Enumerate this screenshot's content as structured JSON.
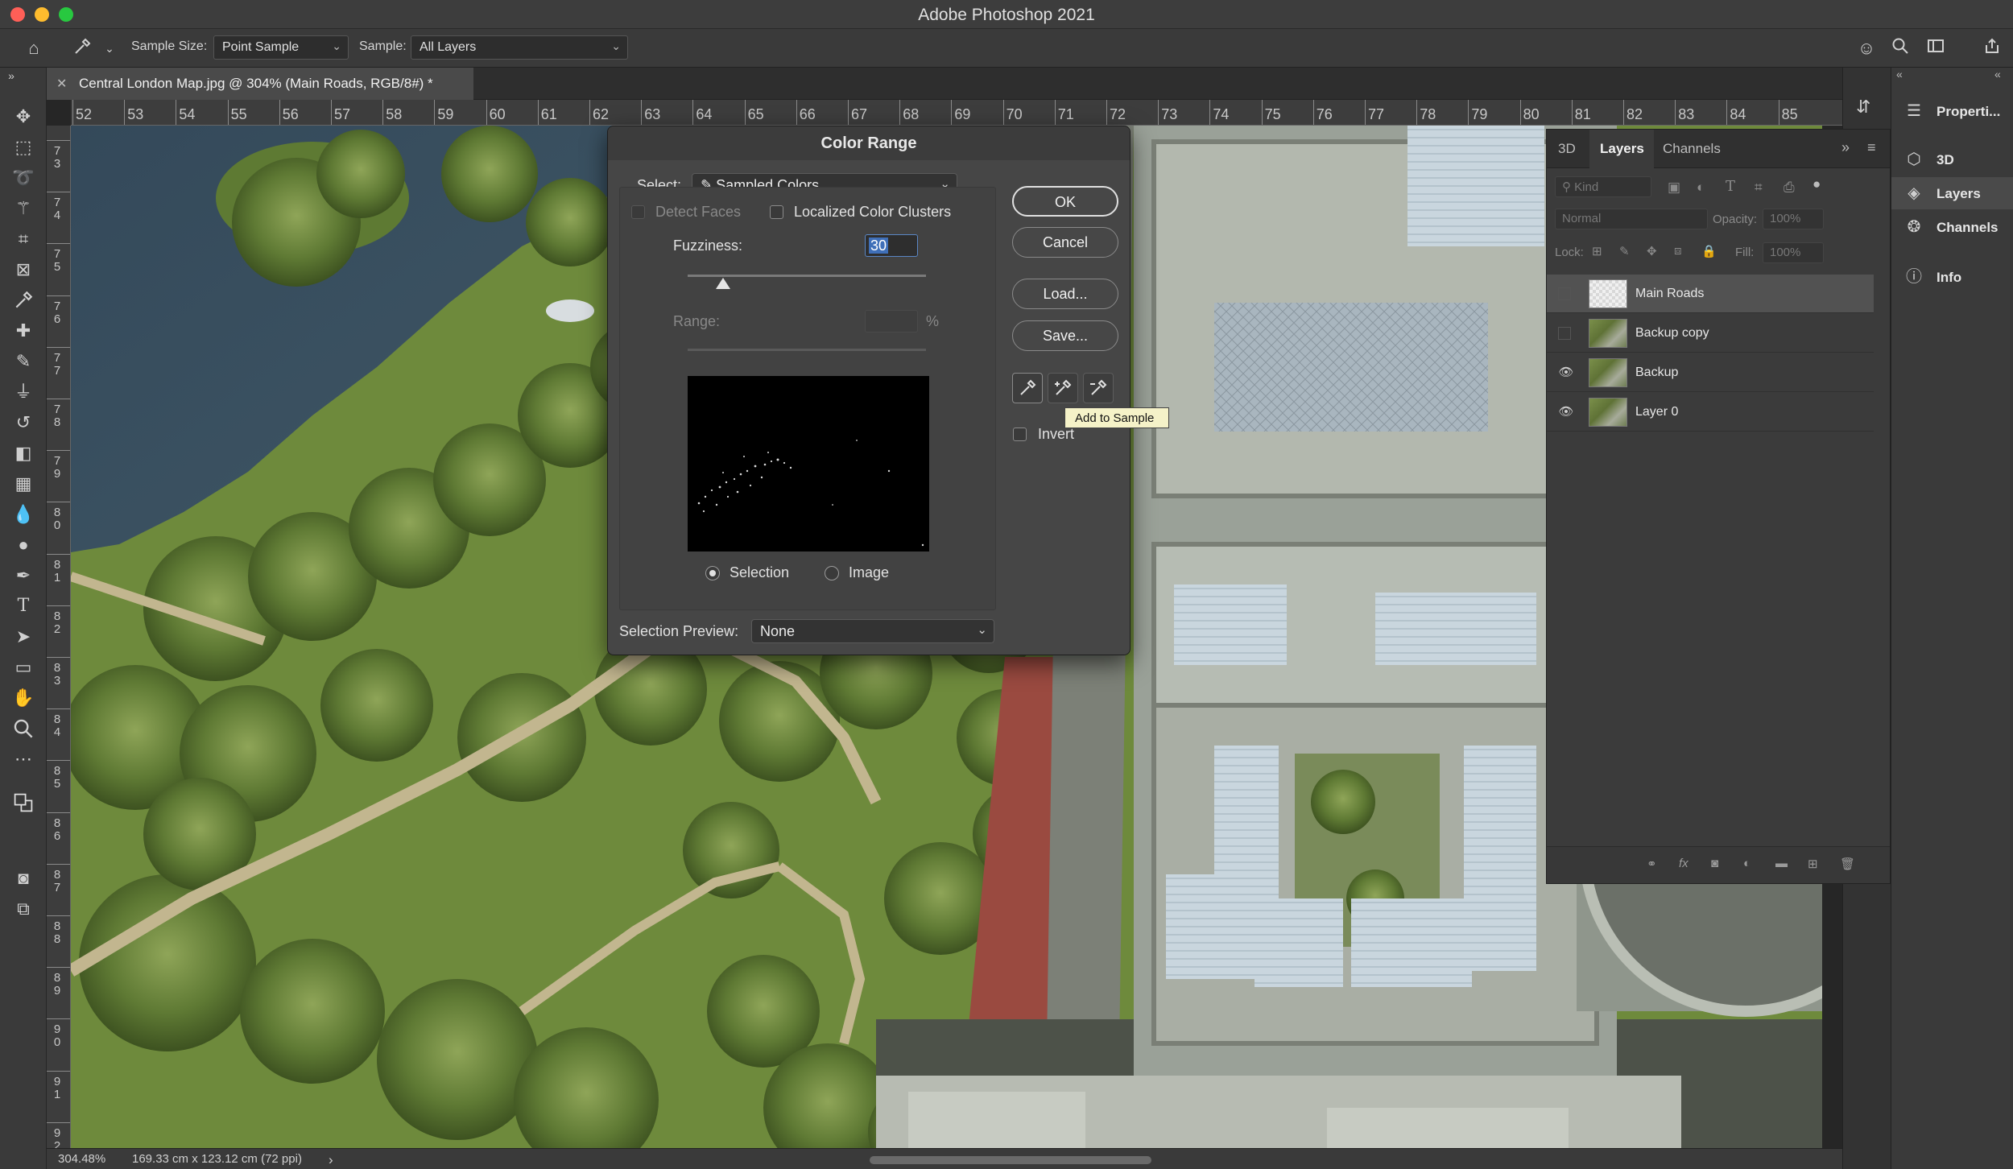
{
  "window": {
    "title": "Adobe Photoshop 2021"
  },
  "options_bar": {
    "tool_icon": "eyedropper-icon",
    "sample_size_label": "Sample Size:",
    "sample_size_value": "Point Sample",
    "sample_label": "Sample:",
    "sample_value": "All Layers",
    "right_icons": [
      "user-icon",
      "search-icon",
      "workspace-icon",
      "share-icon"
    ]
  },
  "document": {
    "tab_title": "Central London Map.jpg @ 304% (Main Roads, RGB/8#) *"
  },
  "rulers": {
    "horizontal": [
      "52",
      "53",
      "54",
      "55",
      "56",
      "57",
      "58",
      "59",
      "60",
      "61",
      "62",
      "63",
      "64",
      "65",
      "66",
      "67",
      "68",
      "69",
      "70",
      "71",
      "72",
      "73",
      "74",
      "75",
      "76",
      "77",
      "78",
      "79",
      "80",
      "81",
      "82",
      "83",
      "84",
      "85"
    ],
    "vertical": [
      "7\n3",
      "7\n4",
      "7\n5",
      "7\n6",
      "7\n7",
      "7\n8",
      "7\n9",
      "8\n0",
      "8\n1",
      "8\n2",
      "8\n3",
      "8\n4",
      "8\n5",
      "8\n6",
      "8\n7",
      "8\n8",
      "8\n9",
      "9\n0",
      "9\n1",
      "9\n2"
    ]
  },
  "status_bar": {
    "zoom": "304.48%",
    "doc_info": "169.33 cm x 123.12 cm (72 ppi)",
    "arrow": "›"
  },
  "dialog": {
    "title": "Color Range",
    "select_label": "Select:",
    "select_value": "Sampled Colors",
    "detect_faces_label": "Detect Faces",
    "localized_label": "Localized Color Clusters",
    "fuzziness_label": "Fuzziness:",
    "fuzziness_value": "30",
    "fuzziness_fraction": 0.15,
    "range_label": "Range:",
    "range_unit": "%",
    "selection_radio_label": "Selection",
    "image_radio_label": "Image",
    "preview_label": "Selection Preview:",
    "preview_value": "None",
    "buttons": {
      "ok": "OK",
      "cancel": "Cancel",
      "load": "Load...",
      "save": "Save..."
    },
    "invert_label": "Invert",
    "tooltip": "Add to Sample"
  },
  "layers_panel": {
    "tabs": [
      "3D",
      "Layers",
      "Channels"
    ],
    "active_tab": "Layers",
    "filter_placeholder": "Kind",
    "blend_mode": "Normal",
    "opacity_label": "Opacity:",
    "opacity_value": "100%",
    "lock_label": "Lock:",
    "fill_label": "Fill:",
    "fill_value": "100%",
    "layers": [
      {
        "name": "Main Roads",
        "visible": false,
        "selected": true
      },
      {
        "name": "Backup copy",
        "visible": false,
        "selected": false
      },
      {
        "name": "Backup",
        "visible": true,
        "selected": false
      },
      {
        "name": "Layer 0",
        "visible": true,
        "selected": false
      }
    ]
  },
  "dock": {
    "items": [
      {
        "label": "Properti...",
        "icon": "properties-icon"
      },
      {
        "label": "3D",
        "icon": "cube-icon"
      },
      {
        "label": "Layers",
        "icon": "layers-icon"
      },
      {
        "label": "Channels",
        "icon": "channels-icon"
      },
      {
        "label": "Info",
        "icon": "info-icon"
      }
    ]
  },
  "colors": {
    "bg": "#262626",
    "panel": "#3a3a3a",
    "selected_row": "#525252",
    "road_red": "#9a4a40"
  }
}
